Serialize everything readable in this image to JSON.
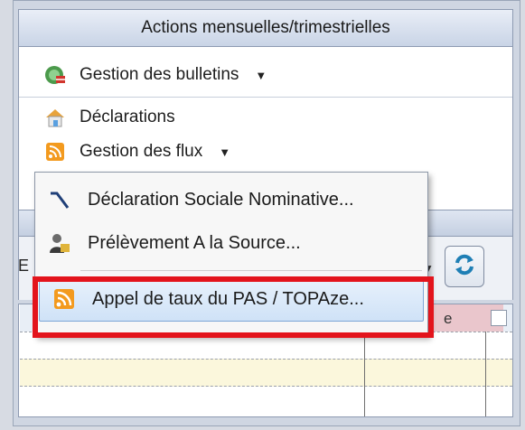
{
  "panel": {
    "title": "Actions mensuelles/trimestrielles",
    "items": [
      {
        "label": "Gestion des bulletins",
        "icon": "bulletins-icon",
        "has_dropdown": true
      },
      {
        "label": "Déclarations",
        "icon": "house-icon",
        "has_dropdown": false
      },
      {
        "label": "Gestion des flux",
        "icon": "rss-icon",
        "has_dropdown": true
      }
    ]
  },
  "dropdown": {
    "items": [
      {
        "label": "Déclaration Sociale Nominative...",
        "icon": "dsn-icon"
      },
      {
        "label": "Prélèvement A la Source...",
        "icon": "user-money-icon"
      },
      {
        "label": "Appel de taux du PAS / TOPAze...",
        "icon": "rss-icon",
        "highlighted": true
      }
    ]
  },
  "toolbar": {
    "combo_partial": "E"
  },
  "grid": {
    "header_partial": "e"
  },
  "colors": {
    "highlight_border": "#e3141c",
    "rss_orange": "#f39a1e"
  }
}
